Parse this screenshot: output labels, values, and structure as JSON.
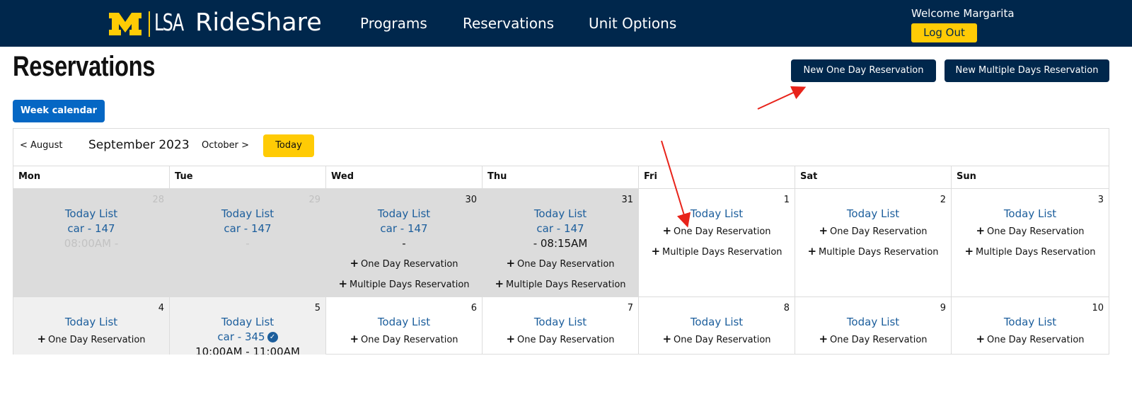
{
  "header": {
    "logo_m": "M",
    "logo_lsa": "LSA",
    "brand": "RideShare",
    "nav": [
      "Programs",
      "Reservations",
      "Unit Options"
    ],
    "welcome": "Welcome Margarita",
    "logout": "Log Out",
    "colors": {
      "bg": "#00274c",
      "accent": "#ffcb05"
    }
  },
  "page": {
    "title": "Reservations",
    "new_one_day": "New One Day Reservation",
    "new_multi_day": "New Multiple Days Reservation",
    "week_calendar": "Week calendar"
  },
  "calendar": {
    "prev_label": "< August",
    "month_label": "September 2023",
    "next_label": "October >",
    "today_label": "Today",
    "days": [
      "Mon",
      "Tue",
      "Wed",
      "Thu",
      "Fri",
      "Sat",
      "Sun"
    ],
    "weeks": [
      [
        {
          "num": "28",
          "state": "past-dim",
          "today_list": "Today List",
          "car": "car - 147",
          "time": "08:00AM -",
          "time_dim": true,
          "one_day": "",
          "multi": ""
        },
        {
          "num": "29",
          "state": "past-dim",
          "today_list": "Today List",
          "car": "car - 147",
          "time": "-",
          "time_dim": true,
          "one_day": "",
          "multi": ""
        },
        {
          "num": "30",
          "state": "past",
          "today_list": "Today List",
          "car": "car - 147",
          "time": "-",
          "time_dim": false,
          "one_day": "One Day Reservation",
          "multi": "Multiple Days Reservation"
        },
        {
          "num": "31",
          "state": "past",
          "today_list": "Today List",
          "car": "car - 147",
          "time": "- 08:15AM",
          "time_dim": false,
          "one_day": "One Day Reservation",
          "multi": "Multiple Days Reservation"
        },
        {
          "num": "1",
          "state": "current",
          "today_list": "Today List",
          "car": "",
          "time": "",
          "time_dim": false,
          "one_day": "One Day Reservation",
          "multi": "Multiple Days Reservation"
        },
        {
          "num": "2",
          "state": "current",
          "today_list": "Today List",
          "car": "",
          "time": "",
          "time_dim": false,
          "one_day": "One Day Reservation",
          "multi": "Multiple Days Reservation"
        },
        {
          "num": "3",
          "state": "current",
          "today_list": "Today List",
          "car": "",
          "time": "",
          "time_dim": false,
          "one_day": "One Day Reservation",
          "multi": "Multiple Days Reservation"
        }
      ],
      [
        {
          "num": "4",
          "state": "faded",
          "today_list": "Today List",
          "car": "",
          "time": "",
          "time_dim": false,
          "one_day": "One Day Reservation",
          "multi": ""
        },
        {
          "num": "5",
          "state": "faded",
          "today_list": "Today List",
          "car": "car - 345",
          "car_check": true,
          "time": "10:00AM - 11:00AM",
          "time_dim": false,
          "one_day": "",
          "multi": ""
        },
        {
          "num": "6",
          "state": "current",
          "today_list": "Today List",
          "car": "",
          "time": "",
          "time_dim": false,
          "one_day": "One Day Reservation",
          "multi": ""
        },
        {
          "num": "7",
          "state": "current",
          "today_list": "Today List",
          "car": "",
          "time": "",
          "time_dim": false,
          "one_day": "One Day Reservation",
          "multi": ""
        },
        {
          "num": "8",
          "state": "current",
          "today_list": "Today List",
          "car": "",
          "time": "",
          "time_dim": false,
          "one_day": "One Day Reservation",
          "multi": ""
        },
        {
          "num": "9",
          "state": "current",
          "today_list": "Today List",
          "car": "",
          "time": "",
          "time_dim": false,
          "one_day": "One Day Reservation",
          "multi": ""
        },
        {
          "num": "10",
          "state": "current",
          "today_list": "Today List",
          "car": "",
          "time": "",
          "time_dim": false,
          "one_day": "One Day Reservation",
          "multi": ""
        }
      ]
    ]
  },
  "icons": {
    "plus": "plus-icon",
    "check": "check-circle-icon",
    "annotation": "red-arrow-icon"
  }
}
